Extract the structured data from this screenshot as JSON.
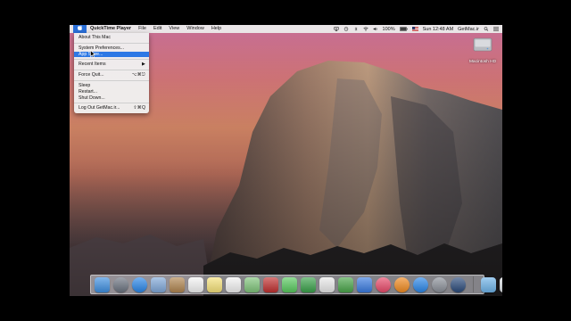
{
  "menubar": {
    "apple_icon": "apple-icon",
    "app_name": "QuickTime Player",
    "menus": [
      "File",
      "Edit",
      "View",
      "Window",
      "Help"
    ],
    "battery": "100%",
    "clock": "Sun 12:48 AM",
    "user": "GetMac.ir"
  },
  "apple_menu": {
    "about": "About This Mac",
    "system_prefs": "System Preferences...",
    "app_store": "App Store...",
    "recent_items": "Recent Items",
    "recent_arrow": "▶",
    "force_quit": "Force Quit...",
    "force_quit_shortcut": "⌥⌘⎋",
    "sleep": "Sleep",
    "restart": "Restart...",
    "shut_down": "Shut Down...",
    "logout": "Log Out GetMac.ir...",
    "logout_shortcut": "⇧⌘Q"
  },
  "desktop": {
    "disk_label": "Macintosh HD"
  },
  "dock": {
    "items": [
      {
        "name": "finder-icon",
        "color": "#3f8fe0"
      },
      {
        "name": "launchpad-icon",
        "color": "#6b7380"
      },
      {
        "name": "safari-icon",
        "color": "#2a86e8"
      },
      {
        "name": "mail-icon",
        "color": "#7fa7d8"
      },
      {
        "name": "contacts-icon",
        "color": "#b08550"
      },
      {
        "name": "calendar-icon",
        "color": "#f4f4f4"
      },
      {
        "name": "notes-icon",
        "color": "#f6e27a"
      },
      {
        "name": "reminders-icon",
        "color": "#f2f2f2"
      },
      {
        "name": "maps-icon",
        "color": "#7fc47a"
      },
      {
        "name": "photo-booth-icon",
        "color": "#c03030"
      },
      {
        "name": "messages-icon",
        "color": "#58c95e"
      },
      {
        "name": "facetime-icon",
        "color": "#3aa14a"
      },
      {
        "name": "pages-icon",
        "color": "#e9e9e9"
      },
      {
        "name": "numbers-icon",
        "color": "#4aa54a"
      },
      {
        "name": "keynote-icon",
        "color": "#3a7be0"
      },
      {
        "name": "itunes-icon",
        "color": "#e84a6a"
      },
      {
        "name": "ibooks-icon",
        "color": "#f08a20"
      },
      {
        "name": "app-store-icon",
        "color": "#2a86e8"
      },
      {
        "name": "system-preferences-icon",
        "color": "#8a8f98"
      },
      {
        "name": "quicktime-icon",
        "color": "#2a4a7a"
      }
    ],
    "right_items": [
      {
        "name": "downloads-folder-icon",
        "color": "#6eb3e8"
      },
      {
        "name": "trash-icon",
        "color": "#d8dde2"
      }
    ]
  }
}
